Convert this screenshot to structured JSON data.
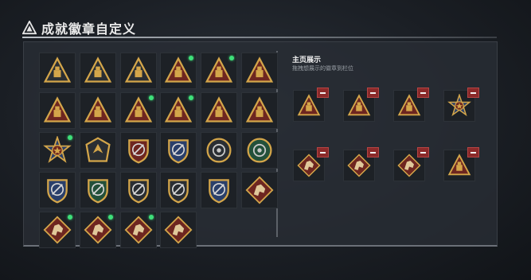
{
  "header": {
    "title": "成就徽章自定义"
  },
  "showcase": {
    "title": "主页展示",
    "subtitle": "拖拽想展示的徽章到栏位"
  },
  "colors": {
    "gold": "#d4a64a",
    "red_fill": "#7a2a22",
    "remove": "#8b2a2a",
    "new_dot": "#3ee07a"
  },
  "badges": [
    {
      "icon": "triangle-mountain-badge-icon",
      "tone": "dark",
      "new": false
    },
    {
      "icon": "triangle-vehicle-badge-icon",
      "tone": "dark",
      "new": false
    },
    {
      "icon": "triangle-wings-badge-icon",
      "tone": "dark",
      "new": false
    },
    {
      "icon": "triangle-helmet-badge-icon",
      "tone": "red",
      "new": true
    },
    {
      "icon": "triangle-grenade-badge-icon",
      "tone": "red",
      "new": true
    },
    {
      "icon": "triangle-medkit-badge-icon",
      "tone": "red",
      "new": false
    },
    {
      "icon": "triangle-backpack-badge-icon",
      "tone": "red",
      "new": false
    },
    {
      "icon": "triangle-hat-badge-icon",
      "tone": "red",
      "new": false
    },
    {
      "icon": "triangle-number-one-badge-icon",
      "tone": "red",
      "new": true
    },
    {
      "icon": "triangle-bottle-badge-icon",
      "tone": "red",
      "new": true
    },
    {
      "icon": "triangle-skull-badge-icon",
      "tone": "red",
      "new": false
    },
    {
      "icon": "triangle-wolf-badge-icon",
      "tone": "red",
      "new": false
    },
    {
      "icon": "star-medal-badge-icon",
      "tone": "red",
      "new": true
    },
    {
      "icon": "pentagon-arrow-badge-icon",
      "tone": "dark",
      "new": false
    },
    {
      "icon": "shield-wings-red-badge-icon",
      "tone": "red",
      "new": false
    },
    {
      "icon": "shield-wings-blue-badge-icon",
      "tone": "blue",
      "new": false
    },
    {
      "icon": "round-skull-badge-icon",
      "tone": "dark",
      "new": false
    },
    {
      "icon": "round-eye-green-badge-icon",
      "tone": "green",
      "new": false
    },
    {
      "icon": "shield-rifle-blue-badge-icon",
      "tone": "blue",
      "new": false
    },
    {
      "icon": "shield-rifle-green-badge-icon",
      "tone": "green",
      "new": false
    },
    {
      "icon": "shield-rifle-dark-badge-icon",
      "tone": "dark",
      "new": false
    },
    {
      "icon": "shield-rifle-gray-badge-icon",
      "tone": "dark",
      "new": false
    },
    {
      "icon": "shield-eagle-gold-badge-icon",
      "tone": "blue",
      "new": false
    },
    {
      "icon": "diamond-beast-badge-icon",
      "tone": "red",
      "new": false
    },
    {
      "icon": "diamond-wolf-badge-icon",
      "tone": "red",
      "new": true
    },
    {
      "icon": "diamond-dragon-badge-icon",
      "tone": "red",
      "new": true
    },
    {
      "icon": "diamond-runner-badge-icon",
      "tone": "red",
      "new": true
    },
    {
      "icon": "diamond-tiger-badge-icon",
      "tone": "red",
      "new": false
    }
  ],
  "showcase_badges": [
    {
      "icon": "triangle-bottle-badge-icon",
      "tone": "red"
    },
    {
      "icon": "triangle-helmet-badge-icon",
      "tone": "red"
    },
    {
      "icon": "triangle-grenade-badge-icon",
      "tone": "red"
    },
    {
      "icon": "star-medal-badge-icon",
      "tone": "red"
    },
    {
      "icon": "diamond-runner-badge-icon",
      "tone": "red"
    },
    {
      "icon": "diamond-dragon-badge-icon",
      "tone": "red"
    },
    {
      "icon": "diamond-wolf-badge-icon",
      "tone": "red"
    },
    {
      "icon": "triangle-number-one-badge-icon",
      "tone": "red"
    }
  ]
}
